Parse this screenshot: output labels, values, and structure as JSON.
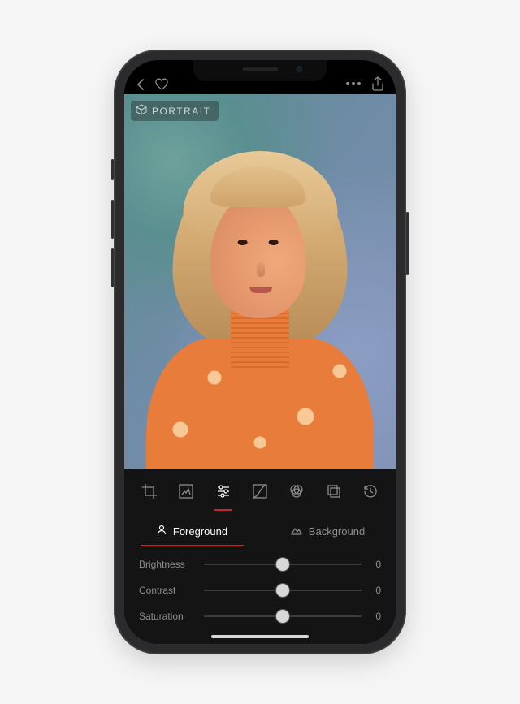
{
  "badge": {
    "label": "PORTRAIT"
  },
  "toolbar": {
    "tools": [
      {
        "name": "crop"
      },
      {
        "name": "frame"
      },
      {
        "name": "adjust",
        "active": true
      },
      {
        "name": "curves"
      },
      {
        "name": "filters"
      },
      {
        "name": "layers"
      },
      {
        "name": "history"
      }
    ]
  },
  "layer_tabs": {
    "foreground": {
      "label": "Foreground",
      "active": true
    },
    "background": {
      "label": "Background",
      "active": false
    }
  },
  "sliders": [
    {
      "name": "brightness",
      "label": "Brightness",
      "value": 0
    },
    {
      "name": "contrast",
      "label": "Contrast",
      "value": 0
    },
    {
      "name": "saturation",
      "label": "Saturation",
      "value": 0
    }
  ]
}
